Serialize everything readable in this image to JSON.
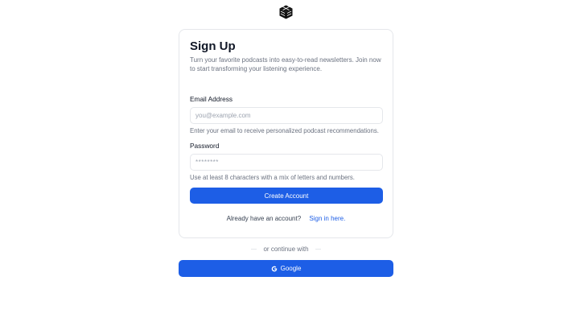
{
  "logo": {
    "icon": "brand-cube-icon"
  },
  "signup": {
    "title": "Sign Up",
    "subtitle": "Turn your favorite podcasts into easy-to-read newsletters. Join now to start transforming your listening experience.",
    "email": {
      "label": "Email Address",
      "value": "",
      "placeholder": "you@example.com",
      "hint": "Enter your email to receive personalized podcast recommendations."
    },
    "password": {
      "label": "Password",
      "value": "",
      "placeholder": "********",
      "hint": "Use at least 8 characters with a mix of letters and numbers."
    },
    "submit_label": "Create Account",
    "signin_prompt": "Already have an account?",
    "signin_link": "Sign in here."
  },
  "alt_auth": {
    "divider_text": "or continue with",
    "google_label": "Google",
    "google_icon": "google-icon"
  },
  "colors": {
    "accent": "#1d5ee6",
    "border": "#e5e7eb",
    "muted_text": "#6b7280"
  }
}
